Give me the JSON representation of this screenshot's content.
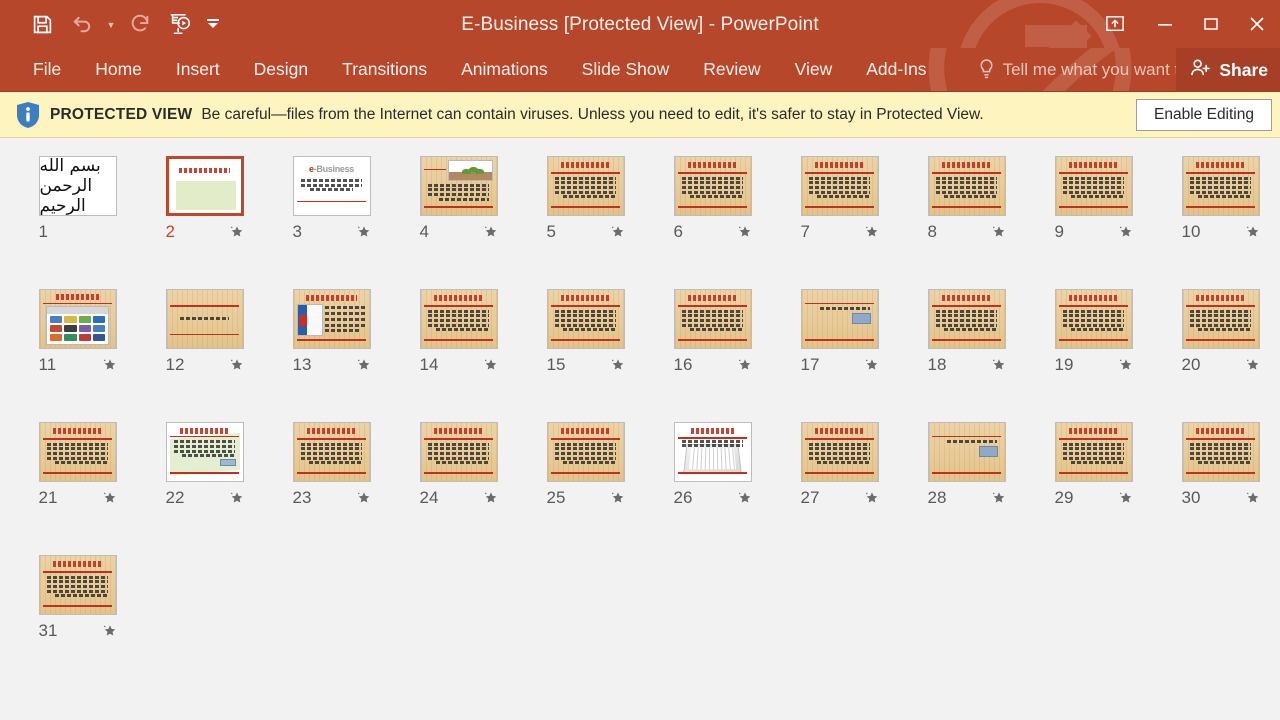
{
  "window": {
    "title": "E-Business [Protected View] - PowerPoint",
    "accent_color": "#b7472a",
    "share_label": "Share",
    "share_bg": "#a63f25"
  },
  "quick_access": {
    "items": [
      {
        "name": "save-icon",
        "label": "Save"
      },
      {
        "name": "undo-icon",
        "label": "Undo"
      },
      {
        "name": "undo-dropdown-icon",
        "label": "Undo options"
      },
      {
        "name": "redo-icon",
        "label": "Redo"
      },
      {
        "name": "start-presentation-icon",
        "label": "Start From Beginning"
      },
      {
        "name": "customize-quick-access-toolbar-icon",
        "label": "Customize Quick Access Toolbar"
      }
    ]
  },
  "window_controls": [
    {
      "name": "ribbon-display-options-icon",
      "label": "Ribbon Display Options"
    },
    {
      "name": "minimize-icon",
      "label": "Minimize"
    },
    {
      "name": "maximize-icon",
      "label": "Maximize"
    },
    {
      "name": "close-icon",
      "label": "Close"
    }
  ],
  "menu": {
    "items": [
      {
        "label": "File"
      },
      {
        "label": "Home"
      },
      {
        "label": "Insert"
      },
      {
        "label": "Design"
      },
      {
        "label": "Transitions"
      },
      {
        "label": "Animations"
      },
      {
        "label": "Slide Show"
      },
      {
        "label": "Review"
      },
      {
        "label": "View"
      },
      {
        "label": "Add-Ins"
      }
    ],
    "tell_me": "Tell me what you want to do."
  },
  "protected_view": {
    "label": "PROTECTED VIEW",
    "message": "Be careful—files from the Internet can contain viruses. Unless you need to edit, it's safer to stay in Protected View.",
    "button": "Enable Editing",
    "bg_color": "#fdf4c0",
    "icon": "info-shield-icon"
  },
  "slide_sorter": {
    "selected_slide": 2,
    "total_slides": 31,
    "background_color": "#f2f2f2",
    "selection_color": "#c0472a",
    "animation_icon": "star-icon",
    "slides": [
      {
        "number": "1",
        "style": "calligraphy",
        "animated": false
      },
      {
        "number": "2",
        "style": "title-green",
        "animated": true
      },
      {
        "number": "3",
        "style": "ebusiness-white",
        "animated": true
      },
      {
        "number": "4",
        "style": "paper-plant-image",
        "animated": true
      },
      {
        "number": "5",
        "style": "paper-text",
        "animated": true
      },
      {
        "number": "6",
        "style": "paper-text",
        "animated": true
      },
      {
        "number": "7",
        "style": "paper-text",
        "animated": true
      },
      {
        "number": "8",
        "style": "paper-text",
        "animated": true
      },
      {
        "number": "9",
        "style": "paper-text",
        "animated": true
      },
      {
        "number": "10",
        "style": "paper-text",
        "animated": true
      },
      {
        "number": "11",
        "style": "paper-screenshot",
        "animated": true
      },
      {
        "number": "12",
        "style": "paper-sparse",
        "animated": true
      },
      {
        "number": "13",
        "style": "paper-website",
        "animated": true
      },
      {
        "number": "14",
        "style": "paper-text",
        "animated": true
      },
      {
        "number": "15",
        "style": "paper-text",
        "animated": true
      },
      {
        "number": "16",
        "style": "paper-text",
        "animated": true
      },
      {
        "number": "17",
        "style": "paper-blue-image",
        "animated": true
      },
      {
        "number": "18",
        "style": "paper-text",
        "animated": true
      },
      {
        "number": "19",
        "style": "paper-text",
        "animated": true
      },
      {
        "number": "20",
        "style": "paper-text",
        "animated": true
      },
      {
        "number": "21",
        "style": "paper-text",
        "animated": true
      },
      {
        "number": "22",
        "style": "white-marketing",
        "animated": true
      },
      {
        "number": "23",
        "style": "paper-text",
        "animated": true
      },
      {
        "number": "24",
        "style": "paper-text",
        "animated": true
      },
      {
        "number": "25",
        "style": "paper-text",
        "animated": true
      },
      {
        "number": "26",
        "style": "white-keyboard",
        "animated": true
      },
      {
        "number": "27",
        "style": "paper-text",
        "animated": true
      },
      {
        "number": "28",
        "style": "paper-blue-image",
        "animated": true
      },
      {
        "number": "29",
        "style": "paper-text",
        "animated": true
      },
      {
        "number": "30",
        "style": "paper-text",
        "animated": true
      },
      {
        "number": "31",
        "style": "paper-text",
        "animated": true
      }
    ]
  }
}
